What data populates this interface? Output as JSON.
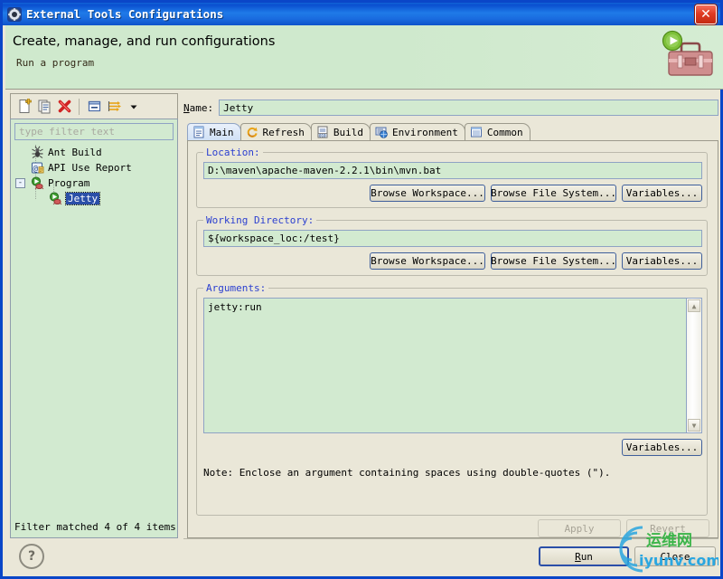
{
  "window": {
    "title": "External Tools Configurations",
    "title_icon": "gear-icon",
    "close_label": "✕"
  },
  "banner": {
    "title": "Create, manage, and run configurations",
    "subtitle": "Run a program",
    "icon": "toolbox-with-green-run-arrow-icon"
  },
  "toolbar": {
    "buttons": [
      {
        "name": "new-configuration-button",
        "icon": "new-document-icon"
      },
      {
        "name": "duplicate-configuration-button",
        "icon": "copy-icon"
      },
      {
        "name": "delete-configuration-button",
        "icon": "red-x-delete-icon"
      },
      {
        "name": "collapse-all-button",
        "icon": "collapse-all-icon"
      },
      {
        "name": "filter-button",
        "icon": "filter-icon"
      },
      {
        "name": "filter-menu-button",
        "icon": "chevron-down-icon"
      }
    ]
  },
  "tree": {
    "filter_placeholder": "type filter text",
    "items": [
      {
        "label": "Ant Build",
        "icon": "ant-icon",
        "level": 0,
        "selected": false,
        "expander": ""
      },
      {
        "label": "API Use Report",
        "icon": "api-use-report-icon",
        "level": 0,
        "selected": false,
        "expander": ""
      },
      {
        "label": "Program",
        "icon": "program-icon",
        "level": 0,
        "selected": false,
        "expander": "-"
      },
      {
        "label": "Jetty",
        "icon": "program-icon",
        "level": 1,
        "selected": true,
        "expander": ""
      }
    ],
    "status": "Filter matched 4 of 4 items"
  },
  "config": {
    "name_label": "Name:",
    "name_value": "Jetty",
    "tabs": [
      {
        "label": "Main",
        "icon": "main-tab-icon",
        "active": true
      },
      {
        "label": "Refresh",
        "icon": "refresh-tab-icon",
        "active": false
      },
      {
        "label": "Build",
        "icon": "build-tab-icon",
        "active": false
      },
      {
        "label": "Environment",
        "icon": "environment-tab-icon",
        "active": false
      },
      {
        "label": "Common",
        "icon": "common-tab-icon",
        "active": false
      }
    ],
    "location": {
      "title": "Location:",
      "value": "D:\\maven\\apache-maven-2.2.1\\bin\\mvn.bat",
      "browse_workspace": "Browse Workspace...",
      "browse_file_system": "Browse File System...",
      "variables": "Variables..."
    },
    "working_directory": {
      "title": "Working Directory:",
      "value": "${workspace_loc:/test}",
      "browse_workspace": "Browse Workspace...",
      "browse_file_system": "Browse File System...",
      "variables": "Variables..."
    },
    "arguments": {
      "title": "Arguments:",
      "value": "jetty:run",
      "variables": "Variables...",
      "note": "Note: Enclose an argument containing spaces using double-quotes (\")."
    }
  },
  "footer": {
    "apply": "Apply",
    "revert": "Revert",
    "run": "Run",
    "close": "Close",
    "help_icon": "?"
  },
  "watermark": {
    "text_cn": "运维网",
    "text_en": "iyunv.com"
  },
  "colors": {
    "titlebar_blue": "#0a4fd0",
    "banner_green": "#cfe9cd",
    "panel_beige": "#eae7d8",
    "field_green": "#d2ead0",
    "group_label_blue": "#2b3fd0",
    "selection_blue": "#2b4fa8"
  }
}
